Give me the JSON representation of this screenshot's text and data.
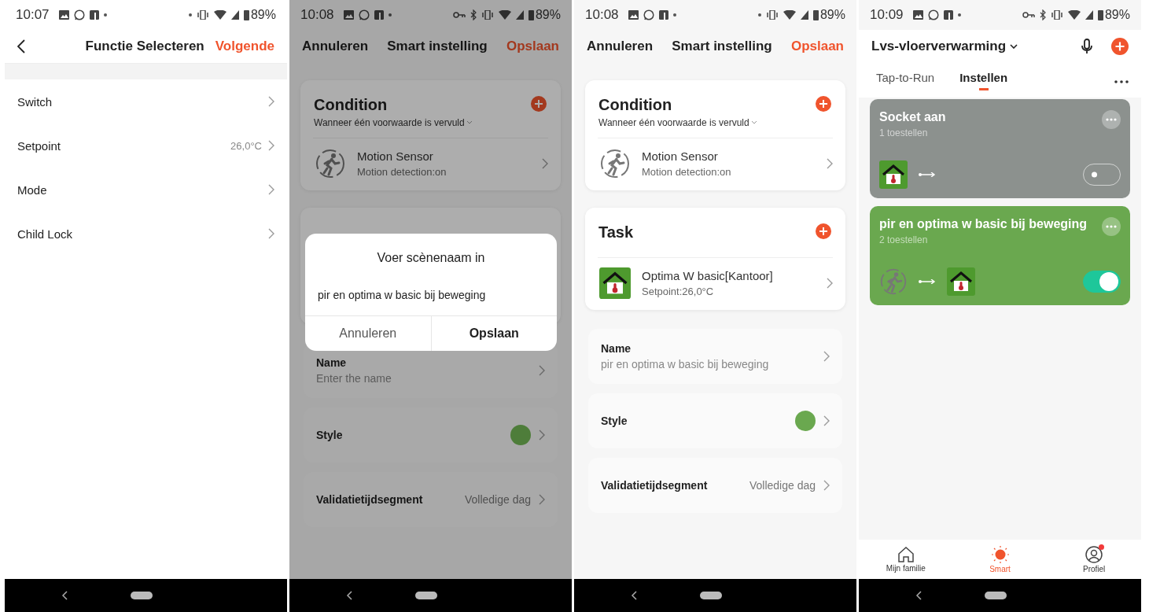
{
  "screens": [
    {
      "kind": "function_select",
      "status_bar": {
        "time": "10:07",
        "vpn": false,
        "battery": "89%"
      },
      "header": {
        "title": "Functie Selecteren",
        "action": "Volgende"
      },
      "items": [
        {
          "label": "Switch"
        },
        {
          "label": "Setpoint",
          "value": "26,0°C"
        },
        {
          "label": "Mode"
        },
        {
          "label": "Child Lock"
        }
      ]
    },
    {
      "kind": "scene_edit",
      "dimmed": true,
      "status_bar": {
        "time": "10:08",
        "vpn": true,
        "battery": "89%"
      },
      "header": {
        "cancel": "Annuleren",
        "title": "Smart instelling",
        "save": "Opslaan"
      },
      "condition": {
        "title": "Condition",
        "subtitle": "Wanneer één voorwaarde is vervuld",
        "items": [
          {
            "kind": "motion",
            "name": "Motion Sensor",
            "detail": "Motion detection:on"
          }
        ]
      },
      "name_row": {
        "label": "Name",
        "placeholder": "Enter the name"
      },
      "style_row": {
        "label": "Style",
        "color": "#4e7d3a"
      },
      "validity_row": {
        "label": "Validatietijdsegment",
        "value": "Volledige dag"
      },
      "dialog": {
        "title": "Voer scènenaam in",
        "value": "pir en optima w basic bij beweging",
        "cancel": "Annuleren",
        "confirm": "Opslaan"
      }
    },
    {
      "kind": "scene_edit",
      "status_bar": {
        "time": "10:08",
        "vpn": false,
        "battery": "89%"
      },
      "header": {
        "cancel": "Annuleren",
        "title": "Smart instelling",
        "save": "Opslaan"
      },
      "condition": {
        "title": "Condition",
        "subtitle": "Wanneer één voorwaarde is vervuld",
        "items": [
          {
            "kind": "motion",
            "name": "Motion Sensor",
            "detail": "Motion detection:on"
          }
        ]
      },
      "task": {
        "title": "Task",
        "items": [
          {
            "kind": "thermostat",
            "name": "Optima W basic[Kantoor]",
            "detail": "Setpoint:26,0°C"
          }
        ]
      },
      "name_row": {
        "label": "Name",
        "value": "pir en optima w basic bij beweging"
      },
      "style_row": {
        "label": "Style",
        "color": "#6aa84f"
      },
      "validity_row": {
        "label": "Validatietijdsegment",
        "value": "Volledige dag"
      }
    },
    {
      "kind": "smart_home",
      "status_bar": {
        "time": "10:09",
        "vpn": true,
        "battery": "89%"
      },
      "header": {
        "home": "Lvs-vloerverwarming"
      },
      "tabs": [
        {
          "label": "Tap-to-Run",
          "selected": false
        },
        {
          "label": "Instellen",
          "selected": true
        }
      ],
      "scenes": [
        {
          "title": "Socket aan",
          "count": "1 toestellen",
          "color": "#8c918e",
          "on": false,
          "devices": [
            {
              "kind": "thermostat"
            }
          ]
        },
        {
          "title": "pir en optima w basic bij beweging",
          "count": "2 toestellen",
          "color": "#6aa84f",
          "on": true,
          "devices": [
            {
              "kind": "motion"
            },
            {
              "kind": "thermostat"
            }
          ]
        }
      ],
      "bottom_nav": [
        {
          "kind": "home",
          "label": "Mijn familie",
          "selected": false,
          "badge": false
        },
        {
          "kind": "smart",
          "label": "Smart",
          "selected": true,
          "badge": false
        },
        {
          "kind": "profile",
          "label": "Profiel",
          "selected": false,
          "badge": true
        }
      ]
    }
  ]
}
